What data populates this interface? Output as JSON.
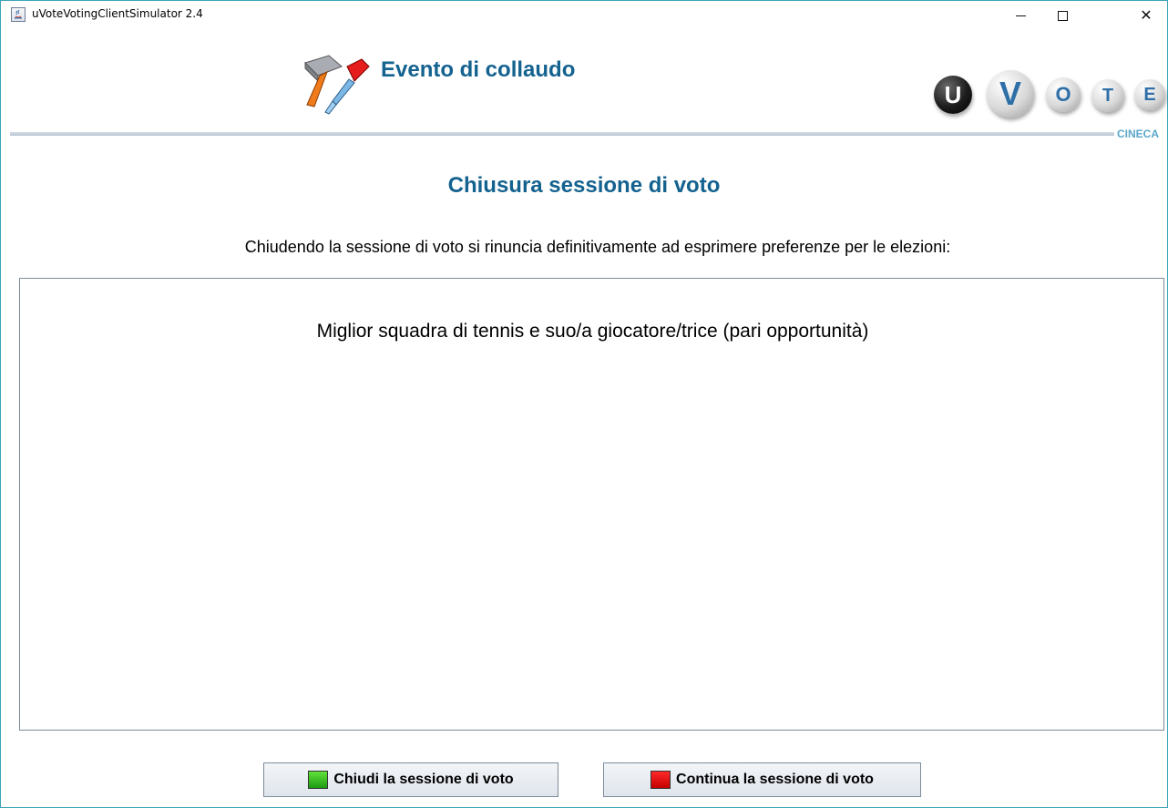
{
  "window": {
    "title": "uVoteVotingClientSimulator 2.4",
    "controls": {
      "minimize": "—",
      "maximize": "☐",
      "close": "✕"
    }
  },
  "header": {
    "event_title": "Evento di collaudo",
    "event_icon": "tools-hammer-screwdriver-icon",
    "logo": {
      "letters": [
        "U",
        "V",
        "O",
        "T",
        "E"
      ]
    },
    "brand": "CINECA"
  },
  "main": {
    "section_title": "Chiusura sessione di voto",
    "description": "Chiudendo la sessione di voto si rinuncia definitivamente ad esprimere preferenze per le elezioni:",
    "elections": [
      "Miglior squadra di tennis e suo/a giocatore/trice (pari opportunità)"
    ]
  },
  "buttons": {
    "close_session": "Chiudi la sessione di voto",
    "continue_session": "Continua la sessione di voto"
  },
  "colors": {
    "title_blue": "#14628f",
    "window_border": "#3aa6b9",
    "cineca": "#5aa7c9",
    "green_indicator": "#2fbf1d",
    "red_indicator": "#e30000"
  }
}
